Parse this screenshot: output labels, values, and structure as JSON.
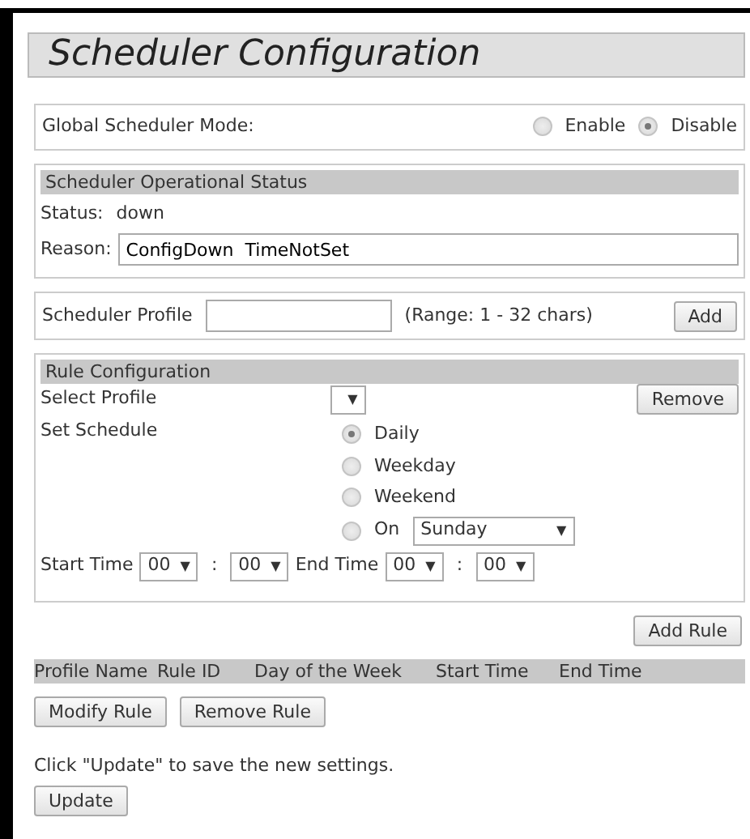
{
  "title": "Scheduler Configuration",
  "global_mode": {
    "label": "Global Scheduler Mode:",
    "options": [
      {
        "label": "Enable",
        "selected": false
      },
      {
        "label": "Disable",
        "selected": true
      }
    ]
  },
  "operational_status": {
    "heading": "Scheduler Operational Status",
    "status_label": "Status:",
    "status_value": "down",
    "reason_label": "Reason:",
    "reason_value": "ConfigDown  TimeNotSet"
  },
  "scheduler_profile": {
    "label": "Scheduler Profile",
    "range": "(Range: 1 - 32 chars)",
    "button": "Add"
  },
  "rule_configuration": {
    "heading": "Rule Configuration",
    "select_profile_label": "Select Profile",
    "select_arrow": "▼",
    "remove_button": "Remove",
    "set_schedule_label": "Set Schedule",
    "schedule_options": [
      {
        "label": "Daily",
        "selected": true,
        "kind": "plain"
      },
      {
        "label": "Weekday",
        "selected": false,
        "kind": "plain"
      },
      {
        "label": "Weekend",
        "selected": false,
        "kind": "plain"
      },
      {
        "label": "On",
        "selected": false,
        "kind": "day",
        "day": "Sunday",
        "arrow": "▼"
      }
    ],
    "times": [
      {
        "label": "Start Time",
        "hour": "00",
        "minute": "00",
        "separator": ":",
        "arrow": "▼"
      },
      {
        "label": "End Time",
        "hour": "00",
        "minute": "00",
        "separator": ":",
        "arrow": "▼"
      }
    ]
  },
  "add_rule_button": "Add Rule",
  "table": {
    "columns": [
      "Profile Name",
      "Rule ID",
      "Day of the Week",
      "Start Time",
      "End Time"
    ]
  },
  "table_buttons": [
    "Modify Rule",
    "Remove Rule"
  ],
  "hint": "Click \"Update\" to save the new settings.",
  "update_button": "Update"
}
